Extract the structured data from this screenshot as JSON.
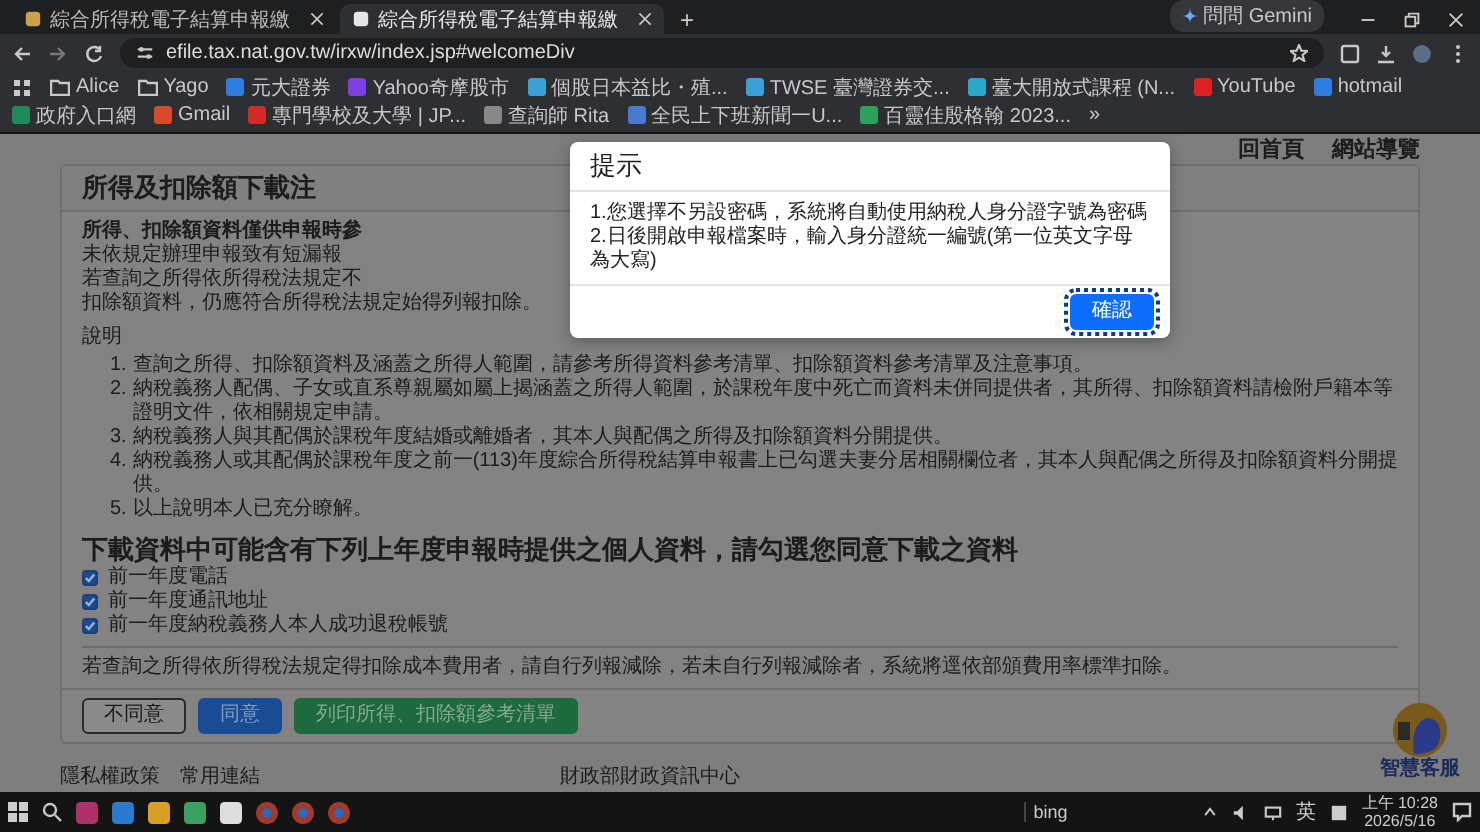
{
  "browser": {
    "tabs": [
      {
        "title": "綜合所得稅電子結算申報繳",
        "selected": false
      },
      {
        "title": "綜合所得稅電子結算申報繳",
        "selected": true
      }
    ],
    "new_tab": "+",
    "gemini": "問問 Gemini",
    "address": "efile.tax.nat.gov.tw/irxw/index.jsp#welcomeDiv",
    "bookmarks": [
      {
        "label": "Alice",
        "kind": "folder"
      },
      {
        "label": "Yago",
        "kind": "folder"
      },
      {
        "label": "元大證券",
        "kind": "site",
        "color": "#2f7de1"
      },
      {
        "label": "Yahoo奇摩股市",
        "kind": "site",
        "color": "#7b3fe4"
      },
      {
        "label": "個股日本益比・殖...",
        "kind": "site",
        "color": "#3aa0d8"
      },
      {
        "label": "TWSE 臺灣證券交...",
        "kind": "site",
        "color": "#3aa0d8"
      },
      {
        "label": "臺大開放式課程 (N...",
        "kind": "site",
        "color": "#2aa7c9"
      },
      {
        "label": "YouTube",
        "kind": "site",
        "color": "#e02020"
      },
      {
        "label": "hotmail",
        "kind": "site",
        "color": "#2f7de1"
      },
      {
        "label": "政府入口網",
        "kind": "site",
        "color": "#1e8a5a"
      },
      {
        "label": "Gmail",
        "kind": "site",
        "color": "#d84a2a"
      },
      {
        "label": "專門學校及大學 | JP...",
        "kind": "site",
        "color": "#d42a2a"
      },
      {
        "label": "查詢師 Rita",
        "kind": "site",
        "color": "#888888"
      },
      {
        "label": "全民上下班新聞一U...",
        "kind": "site",
        "color": "#4a7ad0"
      },
      {
        "label": "百靈佳殷格翰 2023...",
        "kind": "site",
        "color": "#2aa35a"
      }
    ],
    "more_bookmarks": "»"
  },
  "page": {
    "nav_links": [
      "回首頁",
      "網站導覽"
    ],
    "card": {
      "title": "所得及扣除額下載注",
      "intro_lines": [
        {
          "text": "所得、扣除額資料僅供申報時參",
          "bold": true
        },
        {
          "text": "未依規定辦理申報致有短漏報",
          "bold": false
        },
        {
          "text": "若查詢之所得依所得稅法規定不",
          "bold": false
        },
        {
          "text": "扣除額資料，仍應符合所得稅法規定始得列報扣除。",
          "bold": false
        }
      ],
      "notes_heading": "說明",
      "notes": [
        {
          "number": "1.",
          "text": "查詢之所得、扣除額資料及涵蓋之所得人範圍，請參考所得資料參考清單、扣除額資料參考清單及注意事項。"
        },
        {
          "number": "2.",
          "text": "納稅義務人配偶、子女或直系尊親屬如屬上揭涵蓋之所得人範圍，於課稅年度中死亡而資料未併同提供者，其所得、扣除額資料請檢附戶籍本等證明文件，依相關規定申請。"
        },
        {
          "number": "3.",
          "text": "納稅義務人與其配偶於課稅年度結婚或離婚者，其本人與配偶之所得及扣除額資料分開提供。"
        },
        {
          "number": "4.",
          "text": "納稅義務人或其配偶於課稅年度之前一(113)年度綜合所得稅結算申報書上已勾選夫妻分居相關欄位者，其本人與配偶之所得及扣除額資料分開提供。"
        },
        {
          "number": "5.",
          "text": "以上說明本人已充分瞭解。"
        }
      ],
      "consent_heading": "下載資料中可能含有下列上年度申報時提供之個人資料，請勾選您同意下載之資料",
      "consent_items": [
        {
          "label": "前一年度電話",
          "checked": true
        },
        {
          "label": "前一年度通訊地址",
          "checked": true
        },
        {
          "label": "前一年度納稅義務人本人成功退稅帳號",
          "checked": true
        }
      ],
      "remark": "若查詢之所得依所得稅法規定得扣除成本費用者，請自行列報減除，若未自行列報減除者，系統將逕依部頒費用率標準扣除。",
      "buttons": [
        {
          "label": "不同意",
          "kind": "outline"
        },
        {
          "label": "同意",
          "kind": "primary"
        },
        {
          "label": "列印所得、扣除額參考清單",
          "kind": "success"
        }
      ]
    },
    "footer": {
      "links": [
        "隱私權政策",
        "常用連結"
      ],
      "center": "財政部財政資訊中心"
    },
    "chat_widget": "智慧客服"
  },
  "dialog": {
    "title": "提示",
    "lines": [
      "1.您選擇不另設密碼，系統將自動使用納稅人身分證字號為密碼",
      "2.日後開啟申報檔案時，輸入身分證統一編號(第一位英文字母為大寫)"
    ],
    "button": "確認"
  },
  "taskbar": {
    "search": "bing",
    "ime": "英",
    "time": "上午 10:28",
    "date": "2026/5/16"
  }
}
